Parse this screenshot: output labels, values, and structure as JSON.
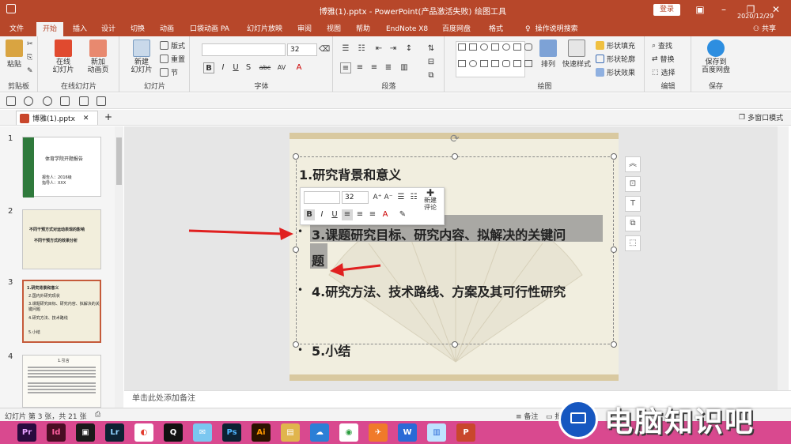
{
  "window": {
    "title": "博雅(1).pptx  -  PowerPoint(产品激活失败)",
    "context_tab": "绘图工具",
    "login_label": "登录"
  },
  "tabs": [
    "文件",
    "开始",
    "插入",
    "设计",
    "切换",
    "动画",
    "口袋动画 PA",
    "幻灯片放映",
    "审阅",
    "视图",
    "帮助",
    "EndNote X8",
    "百度网盘",
    "格式"
  ],
  "active_tab": "开始",
  "tell_me": "操作说明搜索",
  "share": "共享",
  "ribbon": {
    "clipboard": {
      "paste": "粘贴",
      "label": "剪贴板"
    },
    "online_slides": {
      "online": "在线\n幻灯片",
      "new_anim": "新加\n动画页",
      "label": "在线幻灯片"
    },
    "slides": {
      "new_slide": "新建\n幻灯片",
      "layout": "版式",
      "reset": "重置",
      "section": "节",
      "label": "幻灯片"
    },
    "font": {
      "size": "32",
      "label": "字体",
      "bold": "B",
      "italic": "I",
      "underline": "U",
      "shadow": "S",
      "strike": "abc",
      "spacing": "AV"
    },
    "paragraph": {
      "label": "段落"
    },
    "drawing": {
      "arrange": "排列",
      "quick_styles": "快速样式",
      "fill": "形状填充",
      "outline": "形状轮廓",
      "effects": "形状效果",
      "label": "绘图"
    },
    "editing": {
      "find": "查找",
      "replace": "替换",
      "select": "选择",
      "label": "编辑"
    },
    "save": {
      "save_baidu": "保存到\n百度网盘",
      "label": "保存"
    }
  },
  "doc_tab": "博雅(1).pptx",
  "multi_window": "多窗口模式",
  "thumbnails": [
    {
      "num": "1",
      "lines": [
        "体育学院开题报告",
        "报告人：2016级",
        "指导人：XXX"
      ]
    },
    {
      "num": "2",
      "lines": [
        "不同干预方式对运动表现的影响",
        "不同干预方式的效果分析"
      ]
    },
    {
      "num": "3",
      "lines": [
        "1.研究背景和意义",
        "2.国内外研究现状",
        "3.课题研究目标、研究内容、拟解决的关键问题",
        "4.研究方法、技术路线",
        "5.小结"
      ]
    },
    {
      "num": "4",
      "lines": [
        "1.引言"
      ]
    }
  ],
  "slide": {
    "line1": "1.研究背景和意义",
    "line3a": "3.课题研究目标、研究内容、拟解决的关键问",
    "line3b": "题",
    "line4": "4.研究方法、技术路线、方案及其可行性研究",
    "line5": "5.小结",
    "bullet": "•"
  },
  "minibar": {
    "font_size": "32",
    "new_comment": "新建\n评论",
    "bold": "B",
    "italic": "I",
    "underline": "U",
    "font_color": "A"
  },
  "notes_placeholder": "单击此处添加备注",
  "status": {
    "slide_info": "幻灯片 第 3 张，共 21 张",
    "notes": "备注",
    "comments": "批注"
  },
  "taskbar": {
    "apps": [
      {
        "name": "Pr",
        "color": "#2a0a3f",
        "fg": "#e6a0ff"
      },
      {
        "name": "Id",
        "color": "#4a0d24",
        "fg": "#ff5fa0"
      },
      {
        "name": "▣",
        "color": "#1a1a1a",
        "fg": "#ffffff"
      },
      {
        "name": "Lr",
        "color": "#0d2233",
        "fg": "#8fd3ff"
      },
      {
        "name": "◐",
        "color": "#ffffff",
        "fg": "#e23b2e"
      },
      {
        "name": "Q",
        "color": "#111111",
        "fg": "#ffffff"
      },
      {
        "name": "✉",
        "color": "#7bc7f0",
        "fg": "#ffffff"
      },
      {
        "name": "Ps",
        "color": "#0d2233",
        "fg": "#4fb6ff"
      },
      {
        "name": "Ai",
        "color": "#2b1300",
        "fg": "#ff9a00"
      },
      {
        "name": "▤",
        "color": "#e0b54d",
        "fg": "#ffffff"
      },
      {
        "name": "☁",
        "color": "#2b7fd6",
        "fg": "#ffffff"
      },
      {
        "name": "◉",
        "color": "#ffffff",
        "fg": "#2a9d3d"
      },
      {
        "name": "✈",
        "color": "#f07a2a",
        "fg": "#ffffff"
      },
      {
        "name": "W",
        "color": "#2a6ad6",
        "fg": "#ffffff"
      },
      {
        "name": "▥",
        "color": "#bfe3ff",
        "fg": "#2a6ad6"
      },
      {
        "name": "P",
        "color": "#c9472c",
        "fg": "#ffffff"
      }
    ],
    "date": "2020/12/29"
  },
  "watermark": "电脑知识吧",
  "colors": {
    "accent": "#b7472a",
    "taskbar": "#d9498f"
  }
}
